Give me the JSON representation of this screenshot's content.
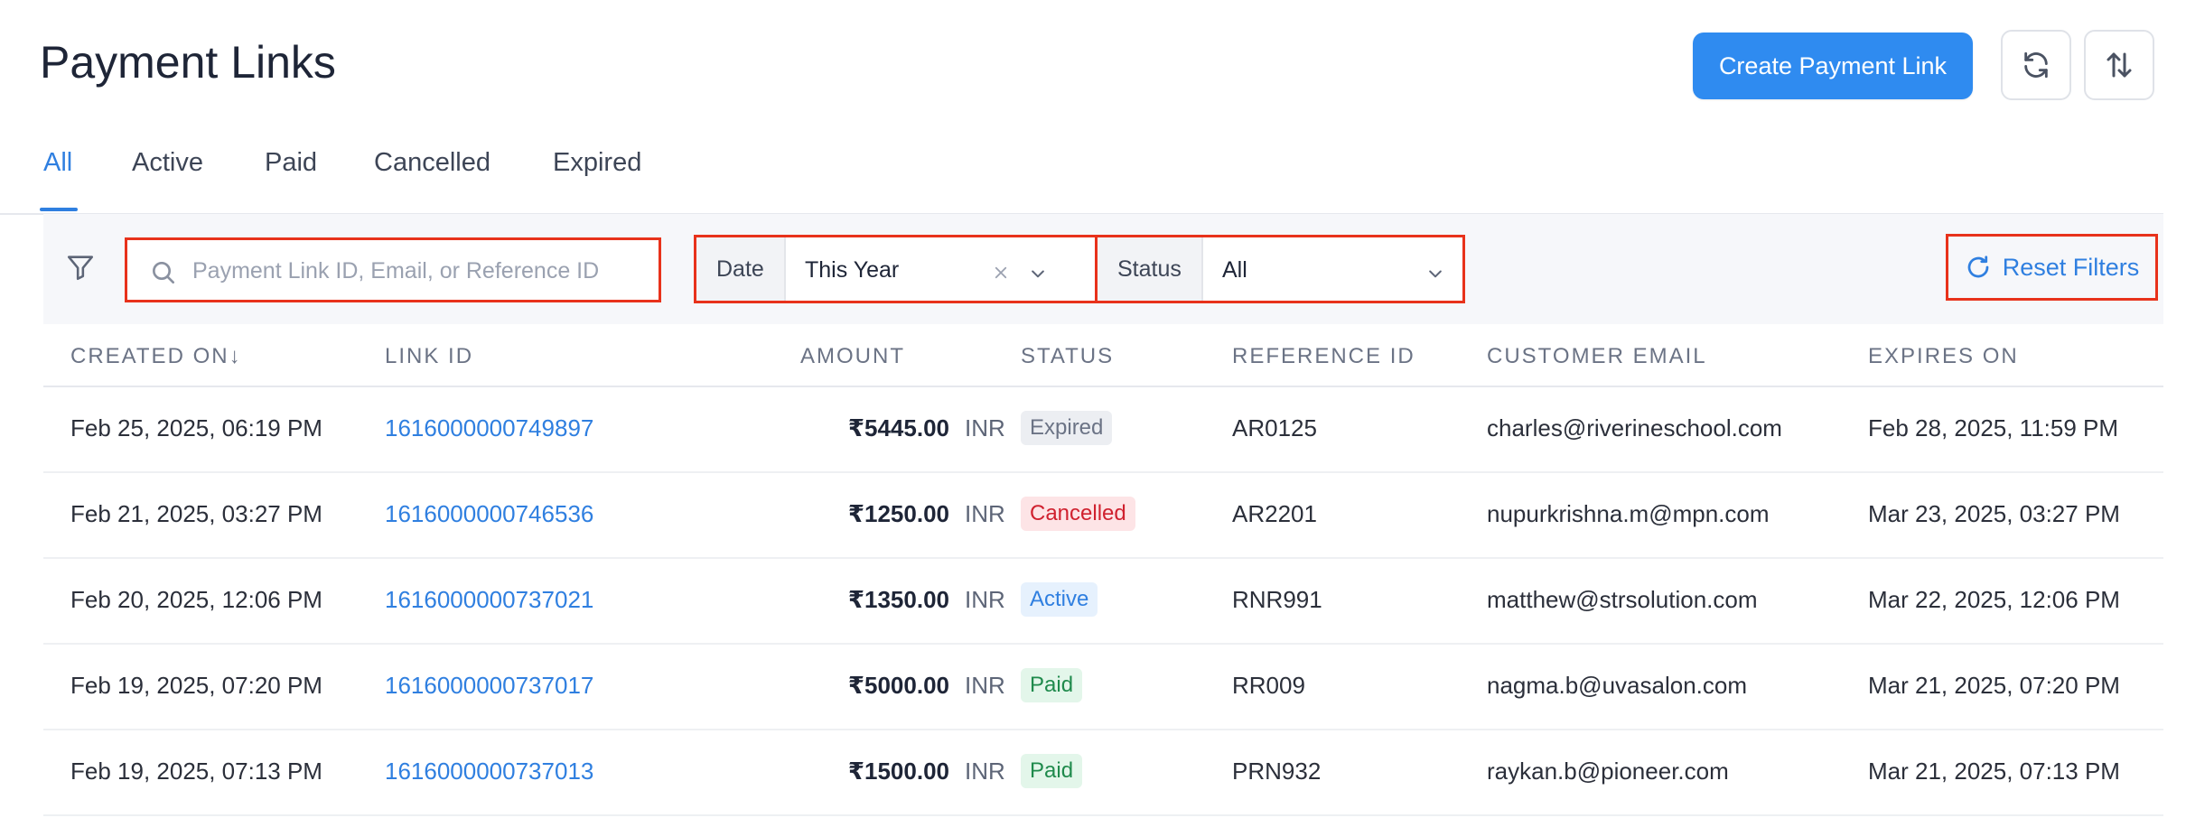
{
  "header": {
    "title": "Payment Links",
    "create_button_label": "Create Payment Link",
    "refresh_icon": "refresh-icon",
    "sort_icon": "sort-icon"
  },
  "tabs": [
    {
      "label": "All",
      "active": true
    },
    {
      "label": "Active",
      "active": false
    },
    {
      "label": "Paid",
      "active": false
    },
    {
      "label": "Cancelled",
      "active": false
    },
    {
      "label": "Expired",
      "active": false
    }
  ],
  "filters": {
    "search_placeholder": "Payment Link ID, Email, or Reference ID",
    "search_value": "",
    "date_label": "Date",
    "date_value": "This Year",
    "status_label": "Status",
    "status_value": "All",
    "reset_label": "Reset Filters"
  },
  "table": {
    "columns": [
      "CREATED ON",
      "LINK ID",
      "AMOUNT",
      "STATUS",
      "REFERENCE ID",
      "CUSTOMER EMAIL",
      "EXPIRES ON"
    ],
    "rows": [
      {
        "created": "Feb 25, 2025, 06:19 PM",
        "link_id": "1616000000749897",
        "amount": "₹5445.00",
        "currency": "INR",
        "status": "Expired",
        "status_kind": "expired",
        "ref": "AR0125",
        "email": "charles@riverineschool.com",
        "expires": "Feb 28, 2025, 11:59 PM"
      },
      {
        "created": "Feb 21, 2025, 03:27 PM",
        "link_id": "1616000000746536",
        "amount": "₹1250.00",
        "currency": "INR",
        "status": "Cancelled",
        "status_kind": "cancelled",
        "ref": "AR2201",
        "email": "nupurkrishna.m@mpn.com",
        "expires": "Mar 23, 2025, 03:27 PM"
      },
      {
        "created": "Feb 20, 2025, 12:06 PM",
        "link_id": "1616000000737021",
        "amount": "₹1350.00",
        "currency": "INR",
        "status": "Active",
        "status_kind": "active",
        "ref": "RNR991",
        "email": "matthew@strsolution.com",
        "expires": "Mar 22, 2025, 12:06 PM"
      },
      {
        "created": "Feb 19, 2025, 07:20 PM",
        "link_id": "1616000000737017",
        "amount": "₹5000.00",
        "currency": "INR",
        "status": "Paid",
        "status_kind": "paid",
        "ref": "RR009",
        "email": "nagma.b@uvasalon.com",
        "expires": "Mar 21, 2025, 07:20 PM"
      },
      {
        "created": "Feb 19, 2025, 07:13 PM",
        "link_id": "1616000000737013",
        "amount": "₹1500.00",
        "currency": "INR",
        "status": "Paid",
        "status_kind": "paid",
        "ref": "PRN932",
        "email": "raykan.b@pioneer.com",
        "expires": "Mar 21, 2025, 07:13 PM"
      }
    ]
  },
  "colors": {
    "accent": "#2f7fe0",
    "primary_button": "#2f8bf0",
    "highlight_box": "#e8321b"
  }
}
